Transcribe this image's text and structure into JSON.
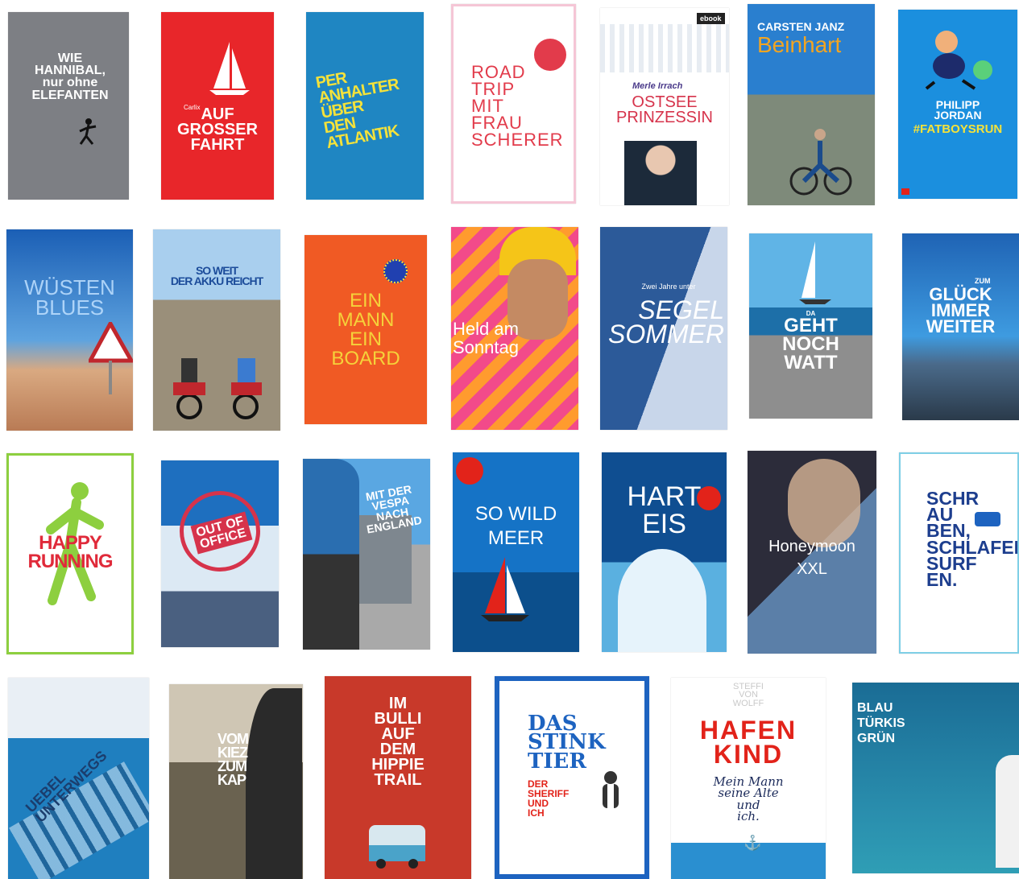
{
  "colors": {
    "hannibal_bg": "#7d7f84",
    "grosser_bg": "#e8262a",
    "atlantik_bg": "#1f86c2",
    "roadtrip_accent": "#e23b4b",
    "jordan_bg": "#1b8fde",
    "happy_red": "#e02a3a",
    "happy_green": "#8dcf3f",
    "bulli_bg": "#c8392a",
    "stinktier_blue": "#1d63c0",
    "hafenkind_red": "#e2231a",
    "blau_bg": "#1f7aa0"
  },
  "covers": [
    {
      "title": "WIE\nHANNIBAL,\nnur ohne\nELEFANTEN"
    },
    {
      "author": "Carlix",
      "title": "AUF\nGROSSER\nFAHRT"
    },
    {
      "title": "PER\nANHALTER\nÜBER\nDEN\nATLANTIK"
    },
    {
      "title": "ROAD\nTRIP\nMIT\nFRAU\nSCHERER"
    },
    {
      "badge": "ebook",
      "author": "Merle Irrach",
      "title": "OSTSEE\nPRINZESSIN"
    },
    {
      "author": "CARSTEN JANZ",
      "title": "Beinhart"
    },
    {
      "author": "PHILIPP\nJORDAN",
      "title": "#FATBOYSRUN"
    },
    {
      "title": "WÜSTEN\nBLUES"
    },
    {
      "title": "SO WEIT\nDER AKKU REICHT"
    },
    {
      "title": "EIN\nMANN\nEIN\nBOARD"
    },
    {
      "title": "Held am\nSonntag"
    },
    {
      "title": "SEGEL\nSOMMER",
      "pre": "Zwei Jahre unter"
    },
    {
      "title": "GEHT\nNOCH\nWATT",
      "pre": "DA"
    },
    {
      "title": "GLÜCK\nIMMER\nWEITER",
      "pre": "ZUM"
    },
    {
      "title": "HAPPY\nRUNNING"
    },
    {
      "title": "OUT OF\nOFFICE"
    },
    {
      "title": "MIT DER VESPA\nNACH ENGLAND"
    },
    {
      "title": "SO WILD\nMEER"
    },
    {
      "title": "HART\nEIS"
    },
    {
      "title": "Honeymoon\nXXL"
    },
    {
      "title": "SCHR\nAU\nBEN,\nSCHLAFEN,\nSURF\nEN."
    },
    {
      "title": "UEBEL UNTERWEGS"
    },
    {
      "title": "VOM\nKIEZ\nZUM\nKAP"
    },
    {
      "title": "IM\nBULLI\nAUF\nDEM\nHIPPIE\nTRAIL"
    },
    {
      "title": "DAS\nSTINK\nTIER",
      "sub": "DER\nSHERIFF\nUND\nICH"
    },
    {
      "author": "STEFFI\nVON\nWOLFF",
      "title": "HAFEN\nKIND",
      "sub": "Mein Mann\nseine Alte\nund\nich."
    },
    {
      "title": "BLAU\nTÜRKIS\nGRÜN"
    }
  ]
}
